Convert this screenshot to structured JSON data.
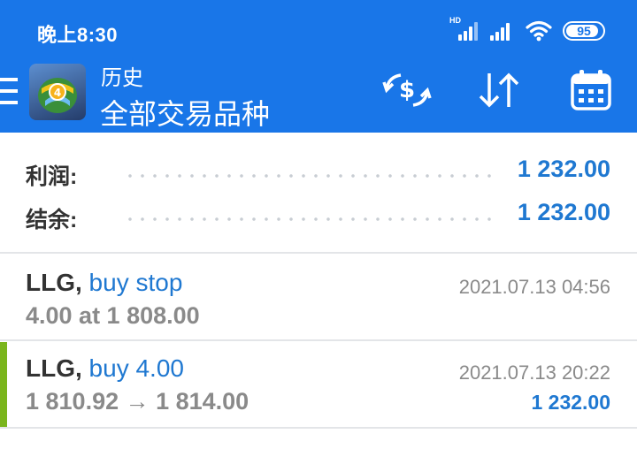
{
  "status_bar": {
    "time": "晚上8:30",
    "network_badge": "HD",
    "battery": "95",
    "icons": [
      "hd-signal-icon",
      "signal-icon",
      "wifi-icon",
      "battery-icon"
    ]
  },
  "app_bar": {
    "title": "历史",
    "subtitle": "全部交易品种",
    "icons": [
      "menu-icon",
      "app-logo-icon",
      "currency-exchange-icon",
      "sort-icon",
      "calendar-icon"
    ]
  },
  "summary": {
    "profit_label": "利润:",
    "profit_value": "1 232.00",
    "balance_label": "结余:",
    "balance_value": "1 232.00"
  },
  "history": [
    {
      "symbol": "LLG,",
      "action": " buy stop",
      "detail": "4.00 at 1 808.00",
      "time": "2021.07.13 04:56",
      "profit": ""
    },
    {
      "symbol": "LLG,",
      "action": " buy 4.00",
      "detail": "1 810.92 → 1 814.00",
      "time": "2021.07.13 20:22",
      "profit": "1 232.00"
    }
  ],
  "colors": {
    "app_bar": "#1976e8",
    "value_blue": "#1f78d1",
    "profit_accent": "#7ab51d"
  }
}
